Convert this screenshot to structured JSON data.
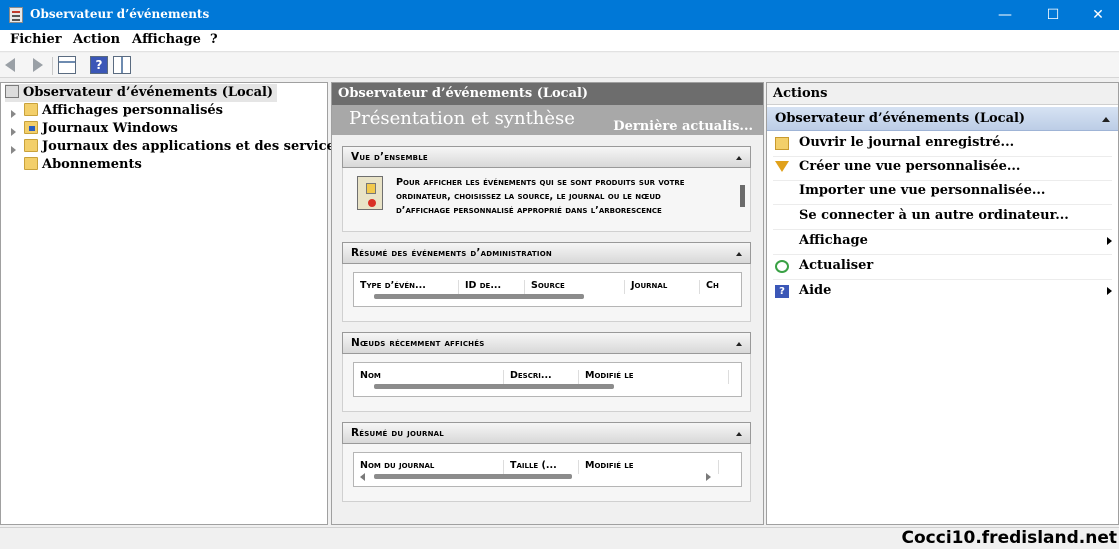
{
  "window": {
    "title": "Observateur d’événements",
    "minimize": "—",
    "maximize": "☐",
    "close": "✕"
  },
  "menu": {
    "items": [
      "Fichier",
      "Action",
      "Affichage",
      "?"
    ]
  },
  "tree": {
    "root": "Observateur d’événements (Local)",
    "items": [
      "Affichages personnalisés",
      "Journaux Windows",
      "Journaux des applications et des services",
      "Abonnements"
    ]
  },
  "center": {
    "header": "Observateur d’événements (Local)",
    "banner_title": "Présentation et synthèse",
    "banner_refresh": "Dernière actualis...",
    "overview": {
      "title": "Vue d’ensemble",
      "text": "Pour afficher les événements qui se sont produits sur votre ordinateur, choisissez la source, le journal ou le nœud d’affichage personnalisé approprié dans l’arborescence"
    },
    "admin_summary": {
      "title": "Résumé des événements d’administration",
      "columns": [
        "Type d’évén...",
        "ID de...",
        "Source",
        "Journal",
        "Ch"
      ]
    },
    "recent_nodes": {
      "title": "Nœuds récemment affichés",
      "columns": [
        "Nom",
        "Descri...",
        "Modifié le"
      ]
    },
    "log_summary": {
      "title": "Résumé du journal",
      "columns": [
        "Nom du journal",
        "Taille (...",
        "Modifié le"
      ]
    }
  },
  "actions": {
    "title": "Actions",
    "group": "Observateur d’événements (Local)",
    "items": [
      {
        "label": "Ouvrir le journal enregistré...",
        "icon": "open-folder-icon"
      },
      {
        "label": "Créer une vue personnalisée...",
        "icon": "filter-icon"
      },
      {
        "label": "Importer une vue personnalisée...",
        "icon": ""
      },
      {
        "label": "Se connecter à un autre ordinateur...",
        "icon": ""
      },
      {
        "label": "Affichage",
        "icon": "",
        "submenu": true
      },
      {
        "label": "Actualiser",
        "icon": "refresh-icon"
      },
      {
        "label": "Aide",
        "icon": "help-icon",
        "submenu": true
      }
    ]
  },
  "watermark": "Cocci10.fredisland.net"
}
